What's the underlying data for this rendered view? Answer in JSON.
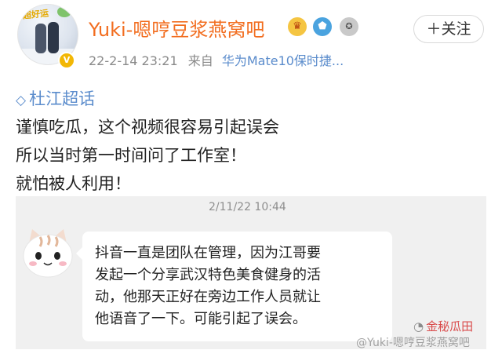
{
  "post": {
    "username": "Yuki-嗯哼豆浆燕窝吧",
    "avatar_badge_text": "超好运",
    "verified_badge": "V",
    "follow_label": "＋关注",
    "timestamp": "22-2-14 23:21",
    "source_prefix": "来自",
    "device": "华为Mate10保时捷...",
    "topic": "杜江超话",
    "body_lines": [
      "谨慎吃瓜，这个视频很容易引起误会",
      "所以当时第一时间问了工作室！",
      "就怕被人利用！"
    ]
  },
  "chat": {
    "time": "2/11/22 10:44",
    "message_lines": [
      "抖音一直是团队在管理，因为江哥要",
      "发起一个分享武汉特色美食健身的活",
      "动，他那天正好在旁边工作人员就让",
      "他语音了一下。可能引起了误会。"
    ]
  },
  "watermarks": {
    "wechat": "金秘瓜田",
    "weibo": "@Yuki-嗯哼豆浆燕窝吧"
  },
  "icons": {
    "crown": "crown-icon",
    "verified": "verified-shield-icon",
    "medal": "medal-icon",
    "topic": "diamond-topic-icon"
  },
  "colors": {
    "username": "#f26d1f",
    "link": "#5b8ccc",
    "chat_background": "#f0f0f0"
  }
}
